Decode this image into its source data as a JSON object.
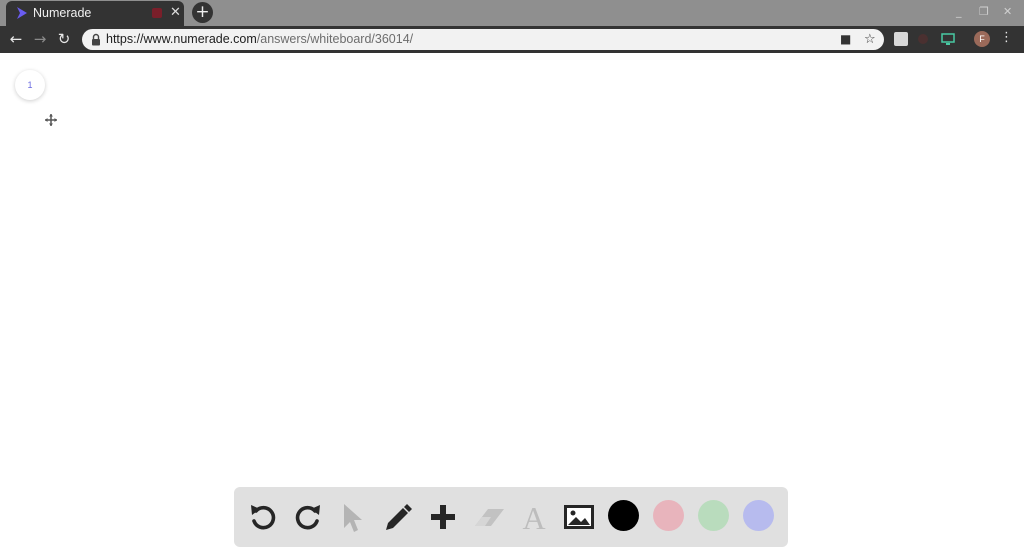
{
  "browser": {
    "tab": {
      "title": "Numerade"
    },
    "new_tab_label": "+",
    "url_host": "https://www.numerade.com",
    "url_path": "/answers/whiteboard/36014/",
    "window_controls": {
      "minimize": "_",
      "restore": "❐",
      "close": "✕"
    },
    "profile_initial": "F"
  },
  "whiteboard": {
    "page_number": "1",
    "tools": [
      "undo-icon",
      "redo-icon",
      "select-icon",
      "pen-icon",
      "add-icon",
      "eraser-icon",
      "text-icon",
      "image-icon"
    ],
    "colors": [
      "#000000",
      "#e8b4bc",
      "#b9dcbd",
      "#b7bbee"
    ],
    "text_tool_glyph": "A"
  }
}
